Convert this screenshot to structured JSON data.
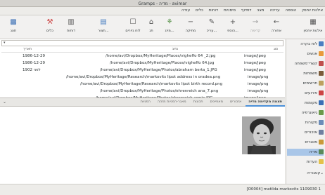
{
  "window": {
    "title": "Gramps - מדיה - avimar"
  },
  "menubar": [
    "אילנות יוחסין",
    "הוספה",
    "עריכה",
    "מצב",
    "דפדוף",
    "סימניות",
    "דוחות",
    "כלים",
    "עזרה"
  ],
  "toolbar": {
    "items": [
      {
        "label": "אילנות יוחסין",
        "icon": "tree-icon"
      },
      {
        "label": "אחורה",
        "icon": "back-arrow-icon"
      },
      {
        "label": "קדימה",
        "icon": "forward-arrow-icon",
        "disabled": true
      },
      {
        "label": "הוספ...",
        "icon": "add-icon"
      },
      {
        "label": "עריכ...",
        "icon": "edit-icon"
      },
      {
        "label": "מחיקה",
        "icon": "remove-icon"
      },
      {
        "label": "מיזג...",
        "icon": "merge-icon"
      },
      {
        "label": "תג",
        "icon": "tag-icon"
      },
      {
        "label": "לוח גזירים",
        "icon": "clipboard-icon"
      },
      {
        "label": "תצור...",
        "icon": "config-icon"
      },
      {
        "label": "דוחות",
        "icon": "reports-icon"
      },
      {
        "label": "כלים",
        "icon": "tools-icon"
      },
      {
        "label": "תצג",
        "icon": "view-icon"
      }
    ]
  },
  "sidebar": {
    "items": [
      {
        "label": "לוח בקרה",
        "icon": "dashboard-icon",
        "color": "#4a7fc1"
      },
      {
        "label": "אנשים",
        "icon": "people-icon",
        "color": "#e89a3c"
      },
      {
        "label": "קשרי־משפחה",
        "icon": "relationships-icon",
        "color": "#c0504d"
      },
      {
        "label": "משפחות",
        "icon": "families-icon",
        "color": "#7a5b3a"
      },
      {
        "label": "תרשימים",
        "icon": "charts-icon",
        "color": "#bca15f"
      },
      {
        "label": "אירועים",
        "icon": "events-icon",
        "color": "#c44"
      },
      {
        "label": "מקומות",
        "icon": "places-icon",
        "color": "#3a6fb5"
      },
      {
        "label": "גיאוגרפיה",
        "icon": "geography-icon",
        "color": "#6a9a4a"
      },
      {
        "label": "מקורות",
        "icon": "sources-icon",
        "color": "#6b8cb8"
      },
      {
        "label": "אזכורים",
        "icon": "citations-icon",
        "color": "#6f7fa0"
      },
      {
        "label": "מאגרים",
        "icon": "repositories-icon",
        "color": "#c99a3a"
      },
      {
        "label": "מדיה",
        "icon": "media-icon",
        "color": "#5a8a5a",
        "active": true
      },
      {
        "label": "הערות",
        "icon": "notes-icon",
        "color": "#e3c14a"
      },
      {
        "label": "קטגוריה",
        "icon": "category-icon",
        "color": "#555"
      }
    ]
  },
  "list": {
    "columns": {
      "type": "סוג",
      "path": "נתיב",
      "date": "תאריך"
    },
    "rows": [
      {
        "date": "1986-12-29",
        "path": "/home/avi/Dropbox/MyHeritage/Places/vigheffo 64 _2.jpg",
        "type": "image/jpeg"
      },
      {
        "date": "1986-12-29",
        "path": "/home/avi/Dropbox/MyHeritage/Places/vigheffo 64.jpg",
        "type": "image/jpeg"
      },
      {
        "date": "לפני 1902",
        "path": "/home/avi/Dropbox/MyHeritage/Photos/abraham berta_1.JPG",
        "type": "image/jpeg"
      },
      {
        "date": "",
        "path": "/home/avi/Dropbox/MyHeritage/Research/markovits lipot address in oradea.png",
        "type": "image/png"
      },
      {
        "date": "",
        "path": "/home/avi/Dropbox/MyHeritage/Research/markovits lipot birth record.png",
        "type": "image/png"
      },
      {
        "date": "",
        "path": "/home/avi/Dropbox/MyHeritage/Photos/ehrenreich ana_7.png",
        "type": "image/png"
      },
      {
        "date": "",
        "path": "/home/avi/Dropbox/MyHeritage/Photos/ehrenreich armin.JPG",
        "type": "image/jpeg"
      }
    ]
  },
  "bottom": {
    "tabs": [
      "תצוגה מקדימה מדיה",
      "אזכורים",
      "מאפיינים",
      "תכונות",
      "מאגר-הפניות מזהה",
      "הפניות"
    ]
  },
  "status": {
    "text": "[O0004] matilda markovits 1109030 1"
  }
}
